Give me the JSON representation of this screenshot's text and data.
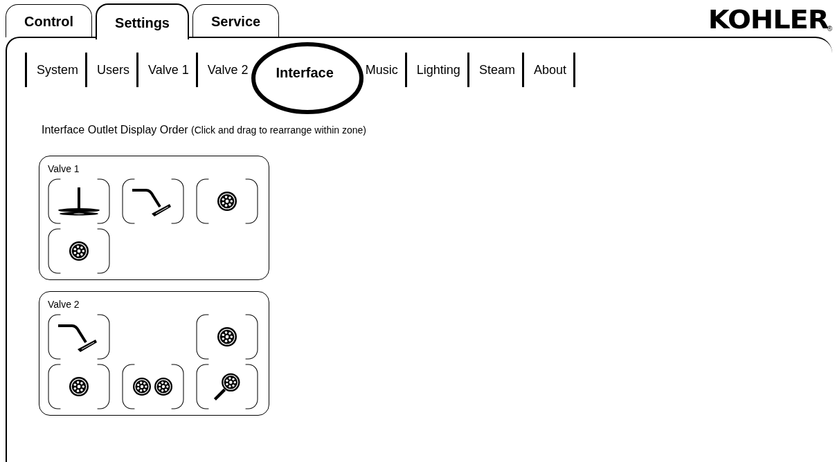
{
  "main_tabs": [
    {
      "label": "Control",
      "selected": false
    },
    {
      "label": "Settings",
      "selected": true
    },
    {
      "label": "Service",
      "selected": false
    }
  ],
  "logo": {
    "text": "KOHLER",
    "mark": "®"
  },
  "sub_tabs": [
    {
      "label": "System",
      "selected": false
    },
    {
      "label": "Users",
      "selected": false
    },
    {
      "label": "Valve 1",
      "selected": false
    },
    {
      "label": "Valve 2",
      "selected": false
    },
    {
      "label": "Interface",
      "selected": true
    },
    {
      "label": "Music",
      "selected": false
    },
    {
      "label": "Lighting",
      "selected": false
    },
    {
      "label": "Steam",
      "selected": false
    },
    {
      "label": "About",
      "selected": false
    }
  ],
  "heading": {
    "title": "Interface Outlet Display Order",
    "hint": "(Click and drag to rearrange within zone)"
  },
  "zones": [
    {
      "title": "Valve 1",
      "outlets": [
        {
          "kind": "rainhead"
        },
        {
          "kind": "showerhead"
        },
        {
          "kind": "bodyspray"
        },
        {
          "kind": "bodyspray"
        }
      ]
    },
    {
      "title": "Valve 2",
      "outlets": [
        {
          "kind": "showerhead"
        },
        {
          "kind": "empty"
        },
        {
          "kind": "bodyspray"
        },
        {
          "kind": "bodyspray"
        },
        {
          "kind": "dual_bodyspray"
        },
        {
          "kind": "handshower"
        }
      ]
    }
  ]
}
